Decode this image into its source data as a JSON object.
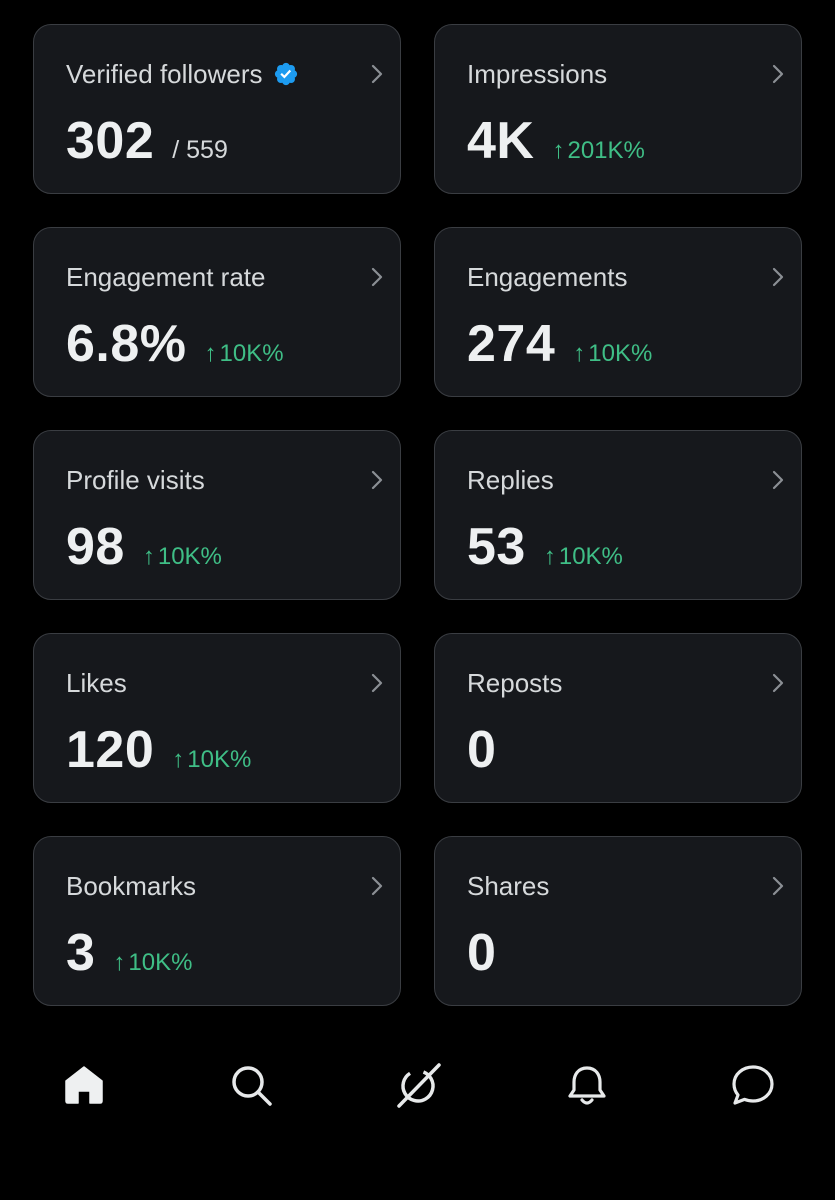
{
  "colors": {
    "background": "#000000",
    "card_background": "#16181c",
    "card_border": "#3a3d42",
    "positive_delta": "#3fbe86",
    "verified_badge": "#1d9bf0"
  },
  "cards": [
    {
      "title": "Verified followers",
      "value": "302",
      "sub": "/ 559",
      "delta": "",
      "badge": "verified-badge-icon"
    },
    {
      "title": "Impressions",
      "value": "4K",
      "sub": "",
      "delta": "201K%"
    },
    {
      "title": "Engagement rate",
      "value": "6.8%",
      "sub": "",
      "delta": "10K%"
    },
    {
      "title": "Engagements",
      "value": "274",
      "sub": "",
      "delta": "10K%"
    },
    {
      "title": "Profile visits",
      "value": "98",
      "sub": "",
      "delta": "10K%"
    },
    {
      "title": "Replies",
      "value": "53",
      "sub": "",
      "delta": "10K%"
    },
    {
      "title": "Likes",
      "value": "120",
      "sub": "",
      "delta": "10K%"
    },
    {
      "title": "Reposts",
      "value": "0",
      "sub": "",
      "delta": ""
    },
    {
      "title": "Bookmarks",
      "value": "3",
      "sub": "",
      "delta": "10K%"
    },
    {
      "title": "Shares",
      "value": "0",
      "sub": "",
      "delta": ""
    }
  ],
  "delta_arrow": "↑",
  "nav": {
    "items": [
      {
        "icon": "home-icon",
        "active": true
      },
      {
        "icon": "search-icon",
        "active": false
      },
      {
        "icon": "grok-icon",
        "active": false
      },
      {
        "icon": "bell-icon",
        "active": false
      },
      {
        "icon": "message-icon",
        "active": false
      }
    ]
  }
}
